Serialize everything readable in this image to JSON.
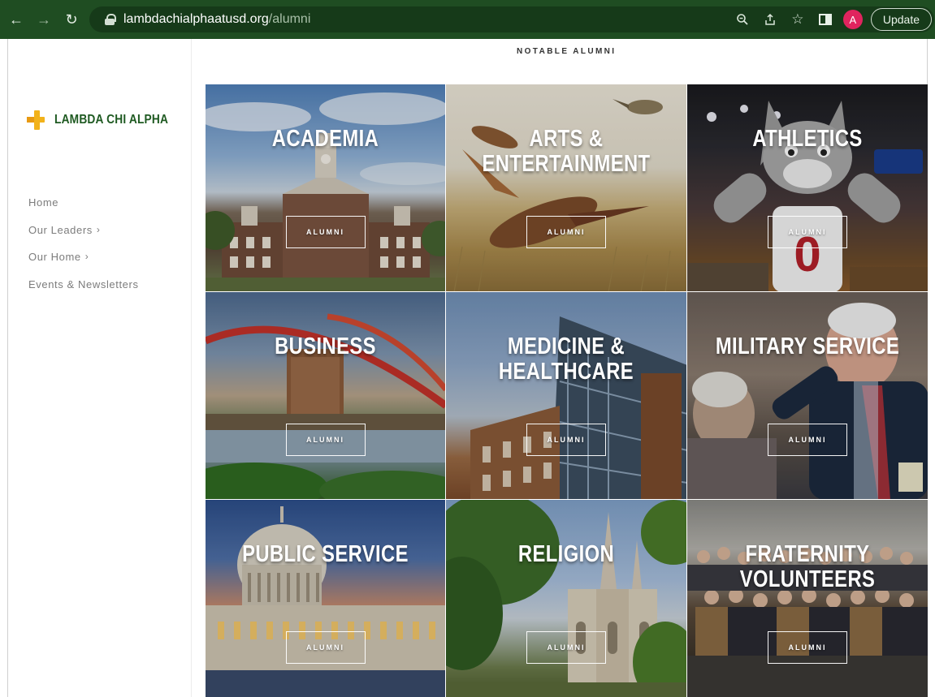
{
  "browser": {
    "url_host": "lambdachialphaatusd.org",
    "url_path": "/alumni",
    "avatar_letter": "A",
    "update_label": "Update"
  },
  "site": {
    "brand_name": "LAMBDA CHI ALPHA",
    "brand_color": "#1f5a22",
    "accent_color": "#f2b21a"
  },
  "nav": {
    "items": [
      {
        "label": "Home",
        "has_submenu": false
      },
      {
        "label": "Our Leaders",
        "has_submenu": true
      },
      {
        "label": "Our Home",
        "has_submenu": true
      },
      {
        "label": "Events & Newsletters",
        "has_submenu": false
      }
    ],
    "chevron": "›"
  },
  "main": {
    "section_title": "NOTABLE ALUMNI",
    "tiles": [
      {
        "title": "ACADEMIA",
        "button": "ALUMNI"
      },
      {
        "title": "ARTS & ENTERTAINMENT",
        "button": "ALUMNI"
      },
      {
        "title": "ATHLETICS",
        "button": "ALUMNI"
      },
      {
        "title": "BUSINESS",
        "button": "ALUMNI"
      },
      {
        "title": "MEDICINE & HEALTHCARE",
        "button": "ALUMNI"
      },
      {
        "title": "MILITARY SERVICE",
        "button": "ALUMNI"
      },
      {
        "title": "PUBLIC SERVICE",
        "button": "ALUMNI"
      },
      {
        "title": "RELIGION",
        "button": "ALUMNI"
      },
      {
        "title": "FRATERNITY VOLUNTEERS",
        "button": "ALUMNI"
      }
    ]
  }
}
